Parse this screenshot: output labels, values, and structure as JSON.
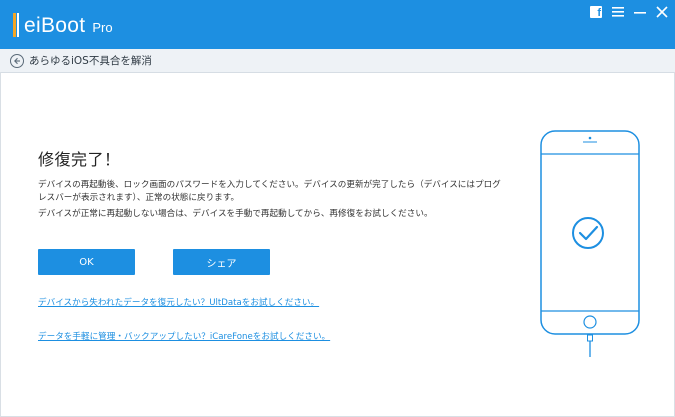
{
  "app": {
    "logo_name": "eiBoot",
    "logo_edition": "Pro"
  },
  "window_controls": {
    "facebook_glyph": "f",
    "menu_icon": "menu-icon",
    "minimize_icon": "minimize-icon",
    "close_icon": "close-icon"
  },
  "nav": {
    "back_icon": "back-arrow-icon",
    "label": "あらゆるiOS不具合を解消"
  },
  "main": {
    "title": "修復完了！",
    "desc_line1": "デバイスの再起動後、ロック画面のパスワードを入力してください。デバイスの更新が完了したら（デバイスにはプログ",
    "desc_line2": "レスバーが表示されます）、正常の状態に戻ります。",
    "desc_line3": "デバイスが正常に再起動しない場合は、デバイスを手動で再起動してから、再修復をお試しください。",
    "ok_button": "OK",
    "share_button": "シェア",
    "link_ultdata": "デバイスから失われたデータを復元したい？UltDataをお試しください。",
    "link_icarefone": "データを手軽に管理・バックアップしたい？iCareFoneをお試しください。"
  },
  "illustration": {
    "name": "phone-success-icon",
    "check_icon": "checkmark-icon"
  },
  "colors": {
    "brand_blue": "#1d8fe1",
    "nav_bg": "#eef2f6",
    "text_dark": "#222222"
  }
}
